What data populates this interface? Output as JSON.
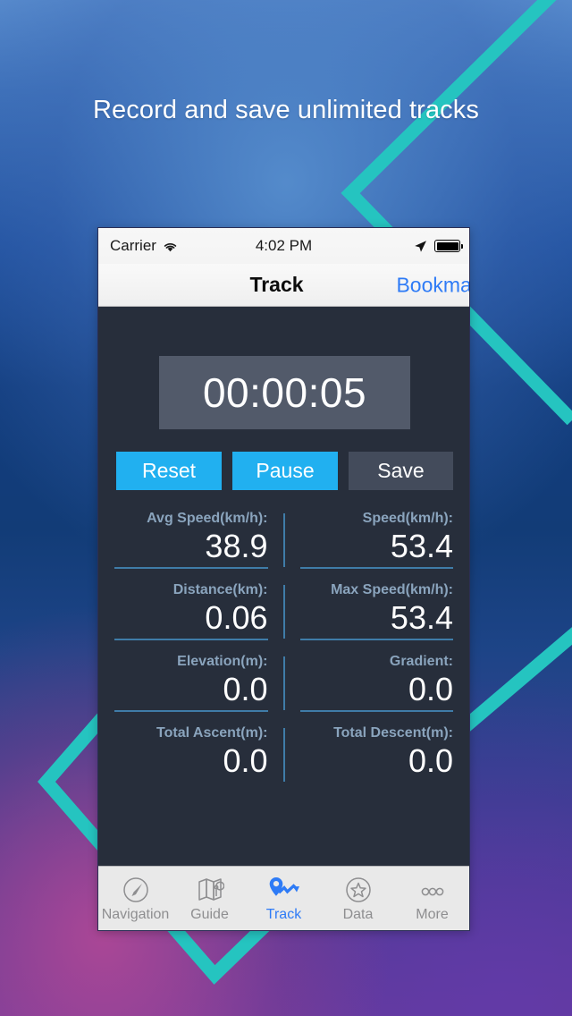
{
  "headline": "Record and save unlimited tracks",
  "colors": {
    "accent_blue": "#21b0f0",
    "tab_active": "#2e7bf6",
    "chevron_teal": "#25c4c0",
    "screen_bg": "#272e3b",
    "timer_bg": "#525a6a",
    "label_blue": "#8aa4bd",
    "divider_blue": "#3f7ca8",
    "save_gray": "#434b5b"
  },
  "phone": {
    "statusbar": {
      "carrier": "Carrier",
      "wifi_icon": "wifi-icon",
      "time": "4:02 PM",
      "location_icon": "location-arrow-icon",
      "battery_icon": "battery-full-icon"
    },
    "navbar": {
      "title": "Track",
      "right_button": "Bookmark"
    },
    "timer": {
      "value": "00:00:05"
    },
    "buttons": [
      {
        "label": "Reset",
        "name": "reset-button",
        "style": "primary"
      },
      {
        "label": "Pause",
        "name": "pause-button",
        "style": "primary"
      },
      {
        "label": "Save",
        "name": "save-button",
        "style": "secondary"
      }
    ],
    "stats": [
      {
        "left": {
          "label": "Avg Speed(km/h):",
          "value": "38.9",
          "underline": true
        },
        "right": {
          "label": "Speed(km/h):",
          "value": "53.4",
          "underline": true
        }
      },
      {
        "left": {
          "label": "Distance(km):",
          "value": "0.06",
          "underline": true
        },
        "right": {
          "label": "Max Speed(km/h):",
          "value": "53.4",
          "underline": true
        }
      },
      {
        "left": {
          "label": "Elevation(m):",
          "value": "0.0",
          "underline": true
        },
        "right": {
          "label": "Gradient:",
          "value": "0.0",
          "underline": true
        }
      },
      {
        "left": {
          "label": "Total Ascent(m):",
          "value": "0.0",
          "underline": false
        },
        "right": {
          "label": "Total Descent(m):",
          "value": "0.0",
          "underline": false
        }
      }
    ],
    "tabs": [
      {
        "label": "Navigation",
        "icon": "compass-icon",
        "active": false
      },
      {
        "label": "Guide",
        "icon": "map-fold-icon",
        "active": false
      },
      {
        "label": "Track",
        "icon": "route-pin-icon",
        "active": true
      },
      {
        "label": "Data",
        "icon": "star-circle-icon",
        "active": false
      },
      {
        "label": "More",
        "icon": "ellipsis-icon",
        "active": false
      }
    ]
  }
}
